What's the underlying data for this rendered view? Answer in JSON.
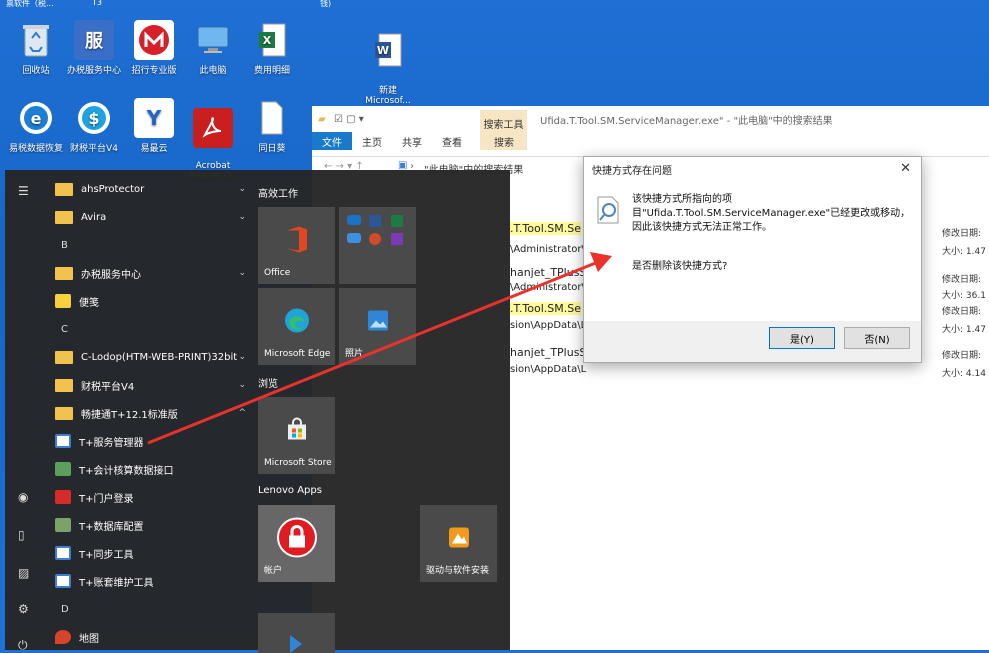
{
  "desktop": {
    "top_strip": [
      "票软件（税...",
      "T3",
      "钱)"
    ],
    "icons": [
      {
        "label": "回收站",
        "icon": "recycle-bin-icon"
      },
      {
        "label": "办税服务中心",
        "icon": "tax-service-icon"
      },
      {
        "label": "招行专业版",
        "icon": "cmb-bank-icon"
      },
      {
        "label": "此电脑",
        "icon": "computer-icon"
      },
      {
        "label": "费用明细",
        "icon": "excel-icon"
      },
      {
        "label": "新建\nMicrosof...",
        "icon": "word-icon"
      },
      {
        "label": "易税数据恢复",
        "icon": "data-recovery-icon"
      },
      {
        "label": "财税平台V4",
        "icon": "tax-platform-icon"
      },
      {
        "label": "易最云",
        "icon": "yizuiyun-icon"
      },
      {
        "label": "Acrobat\nReader DC",
        "icon": "acrobat-icon"
      },
      {
        "label": "同日葵",
        "icon": "file-icon"
      }
    ]
  },
  "explorer": {
    "title": "Ufida.T.Tool.SM.ServiceManager.exe\" - \"此电脑\"中的搜索结果",
    "search_tools_label": "搜索工具",
    "tabs": [
      "文件",
      "主页",
      "共享",
      "查看",
      "搜索"
    ],
    "address": "\"此电脑\"中的搜索结果",
    "results": [
      {
        "name": ".T.Tool.SM.Se",
        "path": "\\Administrator\\A",
        "modified_label": "修改日期:",
        "size": "大小: 1.47"
      },
      {
        "name": "hanjet_TPlusS",
        "path": "\\Administrator\\A",
        "modified_label": "修改日期:",
        "size": "大小: 36.1"
      },
      {
        "name": ".T.Tool.SM.Se",
        "path": "sion\\AppData\\L",
        "modified_label": "修改日期:",
        "size": "大小: 1.47"
      },
      {
        "name": "hanjet_TPlusS",
        "path": "sion\\AppData\\L",
        "modified_label": "修改日期:",
        "size": "大小: 4.14"
      }
    ]
  },
  "dialog": {
    "title": "快捷方式存在问题",
    "message": "该快捷方式所指向的项目\"Ufida.T.Tool.SM.ServiceManager.exe\"已经更改或移动，因此该快捷方式无法正常工作。",
    "question": "是否删除该快捷方式?",
    "yes": "是(Y)",
    "no": "否(N)"
  },
  "start_menu": {
    "items": [
      {
        "label": "ahsProtector",
        "kind": "folder",
        "chev": "⌄"
      },
      {
        "label": "Avira",
        "kind": "folder",
        "chev": "⌄"
      },
      {
        "label": "B",
        "kind": "letter"
      },
      {
        "label": "办税服务中心",
        "kind": "folder",
        "chev": "⌄"
      },
      {
        "label": "便笺",
        "kind": "app",
        "color": "#f7d13c"
      },
      {
        "label": "C",
        "kind": "letter"
      },
      {
        "label": "C-Lodop(HTM-WEB-PRINT)32bit",
        "kind": "folder",
        "chev": "⌄"
      },
      {
        "label": "财税平台V4",
        "kind": "folder",
        "chev": "⌄"
      },
      {
        "label": "畅捷通T+12.1标准版",
        "kind": "folder",
        "chev": "^"
      },
      {
        "label": "T+服务管理器",
        "kind": "app",
        "color": "#3d7fd6"
      },
      {
        "label": "T+会计核算数据接口",
        "kind": "app",
        "color": "#5aa05a"
      },
      {
        "label": "T+门户登录",
        "kind": "app",
        "color": "#d72b2b"
      },
      {
        "label": "T+数据库配置",
        "kind": "app",
        "color": "#7aa36a"
      },
      {
        "label": "T+同步工具",
        "kind": "app",
        "color": "#3d7fd6"
      },
      {
        "label": "T+账套维护工具",
        "kind": "app",
        "color": "#3d7fd6"
      },
      {
        "label": "D",
        "kind": "letter"
      },
      {
        "label": "地图",
        "kind": "app",
        "color": "#d7442b"
      }
    ],
    "sections": {
      "productivity": "高效工作",
      "browse": "浏览",
      "lenovo": "Lenovo Apps"
    },
    "tiles": {
      "office": "Office",
      "edge": "Microsoft Edge",
      "photos": "照片",
      "store": "Microsoft Store",
      "account": "帐户",
      "driver": "驱动与软件安装"
    }
  },
  "colors": {
    "accent": "#0078d7",
    "arrow": "#e8322b",
    "highlight": "#fffb9c"
  }
}
